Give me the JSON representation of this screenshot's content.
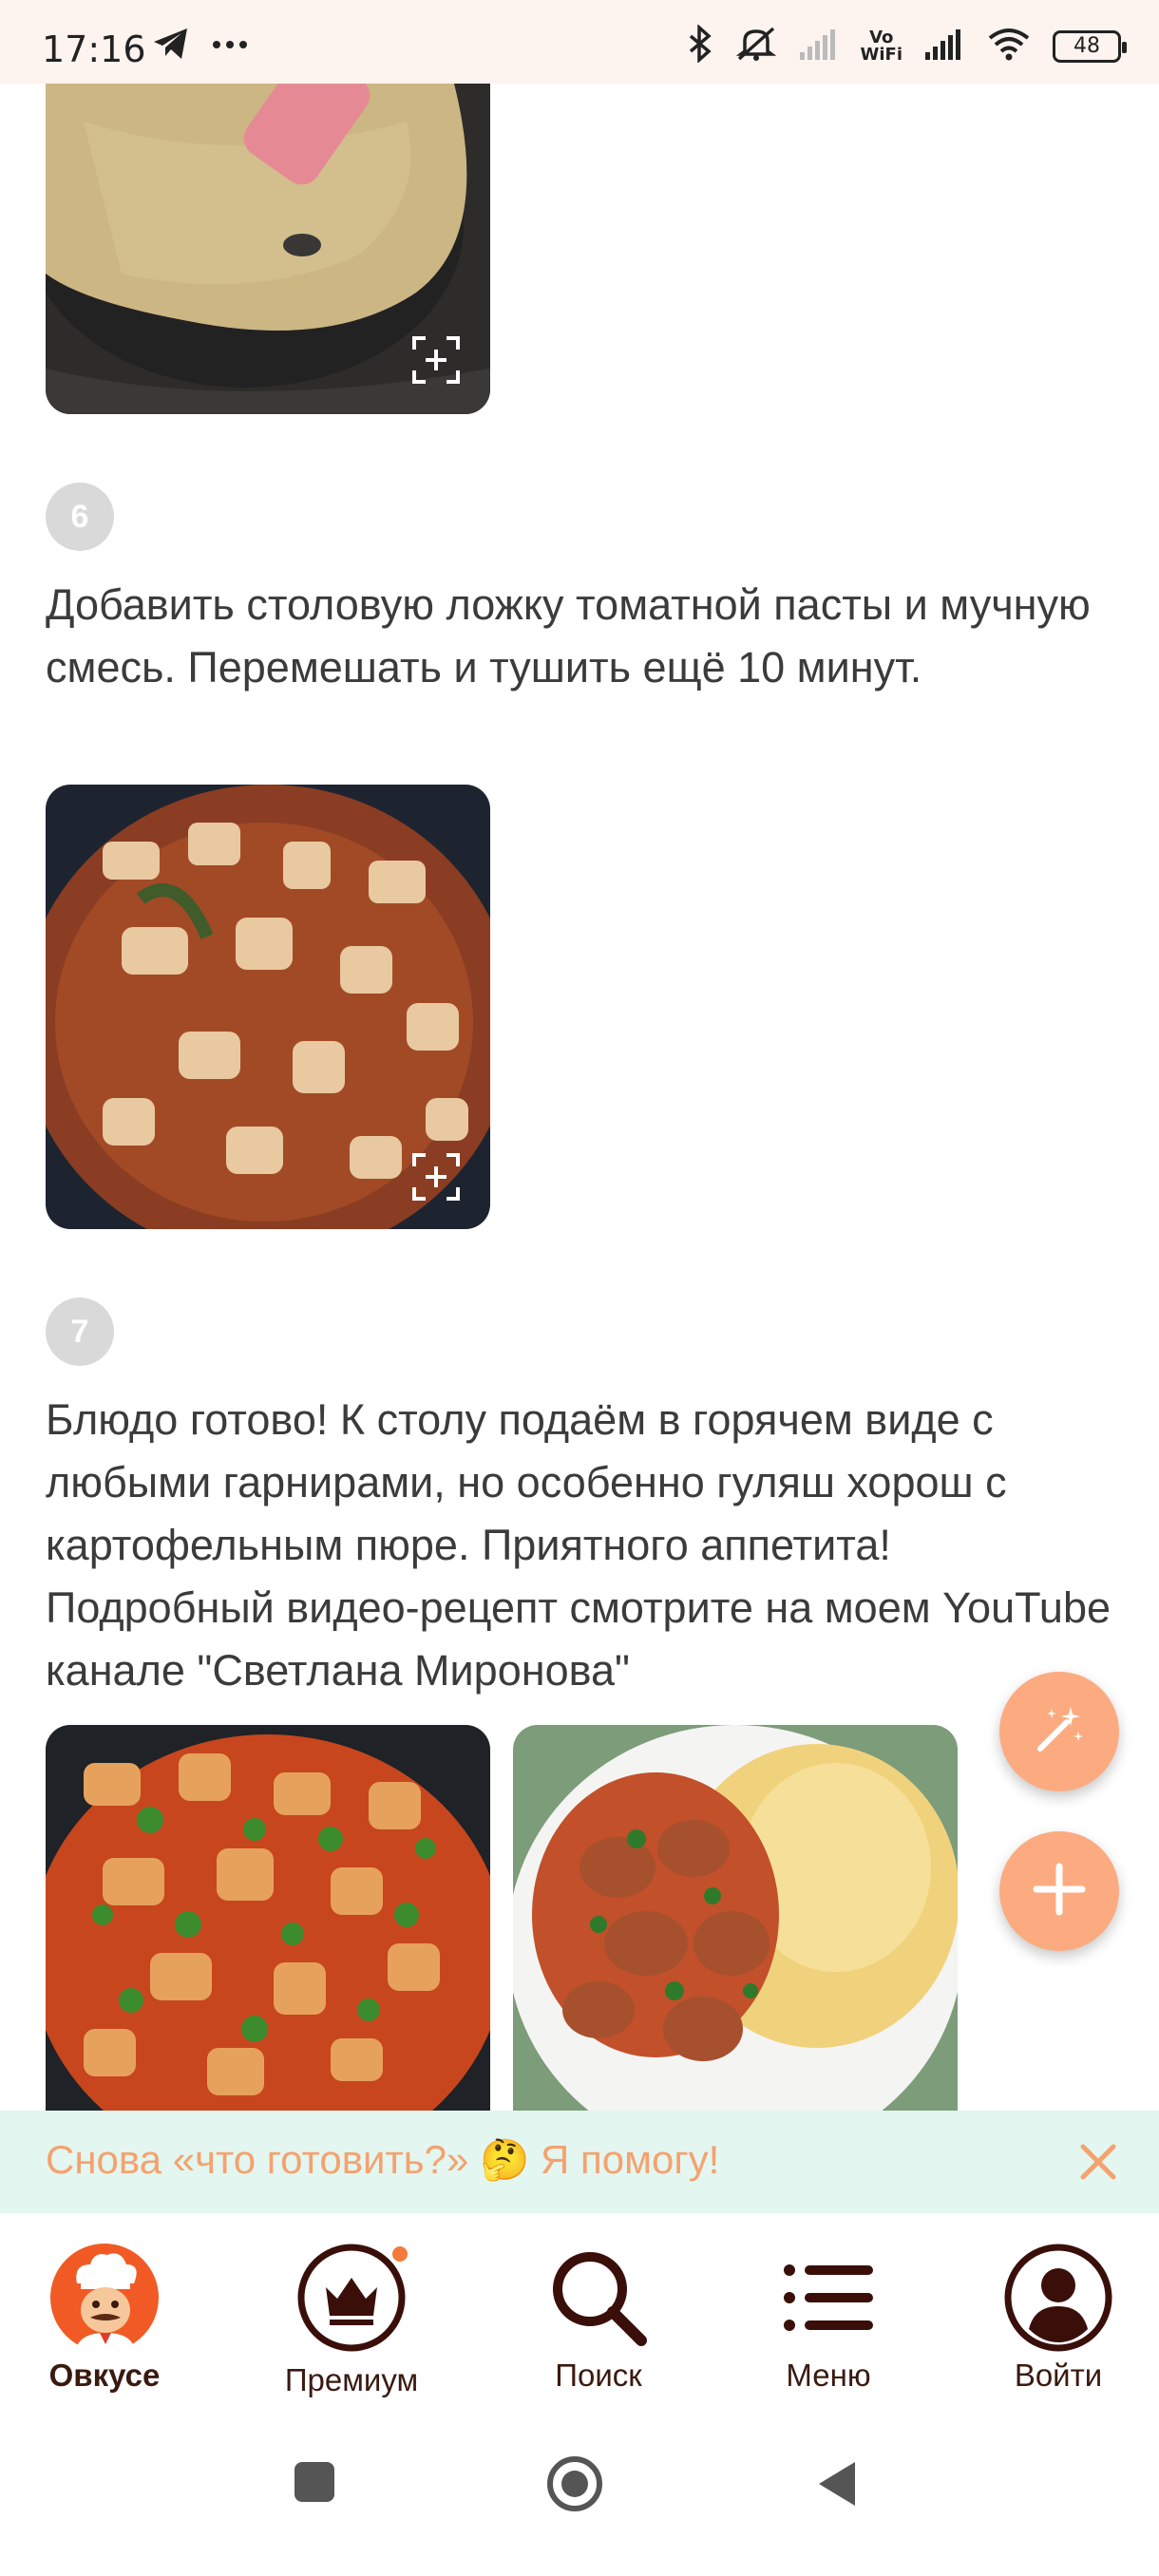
{
  "status_bar": {
    "time": "17:16",
    "left_icons": [
      "telegram-icon",
      "more-dots-icon"
    ],
    "right_icons": [
      "bluetooth-icon",
      "mute-icon",
      "signal-icon",
      "vowifi-icon",
      "signal-icon",
      "wifi-icon"
    ],
    "vowifi_top": "Vo",
    "vowifi_bottom": "WiFi",
    "battery": "48"
  },
  "steps": [
    {
      "number": "6",
      "text": "Добавить столовую ложку томатной пасты и мучную смесь. Перемешать и тушить ещё 10 минут."
    },
    {
      "number": "7",
      "text": "Блюдо готово! К столу подаём в горячем виде с любыми гарнирами, но особенно гуляш хорош с картофельным пюре. Приятного аппетита! Подробный видео-рецепт смотрите на моем YouTube канале \"Светлана Миронова\""
    }
  ],
  "fabs": [
    "magic-wand-icon",
    "plus-icon"
  ],
  "tip_banner": {
    "text": "Снова «что готовить?» 🤔 Я помогу!"
  },
  "bottom_nav": [
    {
      "label": "Овкусе",
      "icon": "chef-avatar-icon",
      "active": true
    },
    {
      "label": "Премиум",
      "icon": "crown-icon",
      "active": false
    },
    {
      "label": "Поиск",
      "icon": "search-icon",
      "active": false
    },
    {
      "label": "Меню",
      "icon": "menu-list-icon",
      "active": false
    },
    {
      "label": "Войти",
      "icon": "profile-icon",
      "active": false
    }
  ],
  "colors": {
    "accent": "#fcab80",
    "brand_dark": "#3a0f0a",
    "tip_bg": "#e3f6ef",
    "tip_text": "#f4a26f",
    "badge": "#d9d9d9",
    "notification_dot": "#f47a3a"
  }
}
